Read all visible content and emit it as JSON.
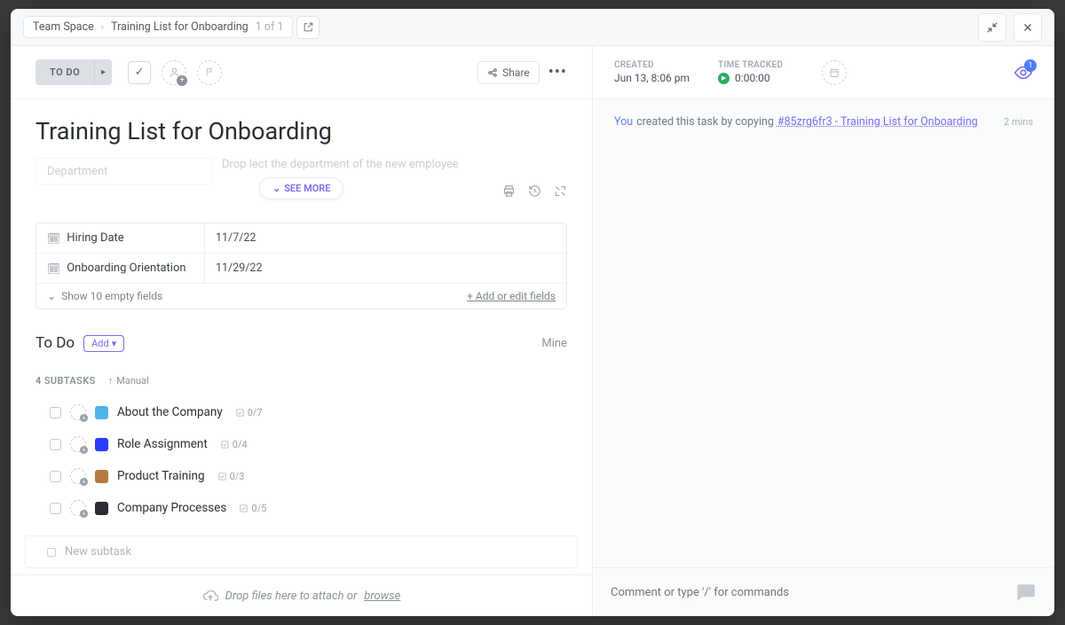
{
  "breadcrumb": {
    "space": "Team Space",
    "item": "Training List for Onboarding",
    "count": "1 of 1"
  },
  "toolbar": {
    "status": "TO DO",
    "share": "Share"
  },
  "title": "Training List for Onboarding",
  "faded": {
    "field": "Department",
    "hint": "Drop               lect the department of the new employee"
  },
  "see_more": "SEE MORE",
  "custom_fields": {
    "rows": [
      {
        "label": "Hiring Date",
        "value": "11/7/22"
      },
      {
        "label": "Onboarding Orientation",
        "value": "11/29/22"
      }
    ],
    "show_empty": "Show 10 empty fields",
    "add_edit": "+ Add or edit fields"
  },
  "subtasks": {
    "section_title": "To Do",
    "add": "Add",
    "mine": "Mine",
    "count_label": "4 SUBTASKS",
    "sort": "Manual",
    "items": [
      {
        "name": "About the Company",
        "progress": "0/7",
        "icon": "ic1"
      },
      {
        "name": "Role Assignment",
        "progress": "0/4",
        "icon": "ic2"
      },
      {
        "name": "Product Training",
        "progress": "0/3",
        "icon": "ic3"
      },
      {
        "name": "Company Processes",
        "progress": "0/5",
        "icon": "ic4"
      }
    ],
    "new_placeholder": "New subtask"
  },
  "drop": {
    "text": "Drop files here to attach or ",
    "browse": "browse"
  },
  "right": {
    "created_label": "CREATED",
    "created_value": "Jun 13, 8:06 pm",
    "time_label": "TIME TRACKED",
    "time_value": "0:00:00",
    "watch_count": "1",
    "activity": {
      "you": "You",
      "text": "created this task by copying",
      "link": "#85zrg6fr3 - Training List for Onboarding",
      "time": "2 mins"
    },
    "comment_placeholder": "Comment or type '/' for commands"
  }
}
